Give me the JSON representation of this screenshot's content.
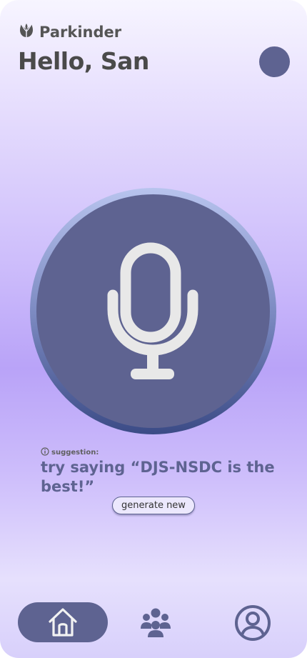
{
  "header": {
    "app_name": "Parkinder",
    "greeting": "Hello, San"
  },
  "icons": {
    "logo": "tulip-icon",
    "avatar": "avatar",
    "mic": "microphone-icon",
    "info": "info-icon",
    "nav_home": "home-icon",
    "nav_community": "community-icon",
    "nav_profile": "profile-icon"
  },
  "suggestion": {
    "label": "suggestion:",
    "text": "try saying “DJS-NSDC is the best!”",
    "button_label": "generate new"
  },
  "colors": {
    "accent": "#5e6391",
    "mic_glyph": "#e8e8e8",
    "text_dark": "#4a4a4a",
    "background_purple": "#b9a3f8"
  }
}
